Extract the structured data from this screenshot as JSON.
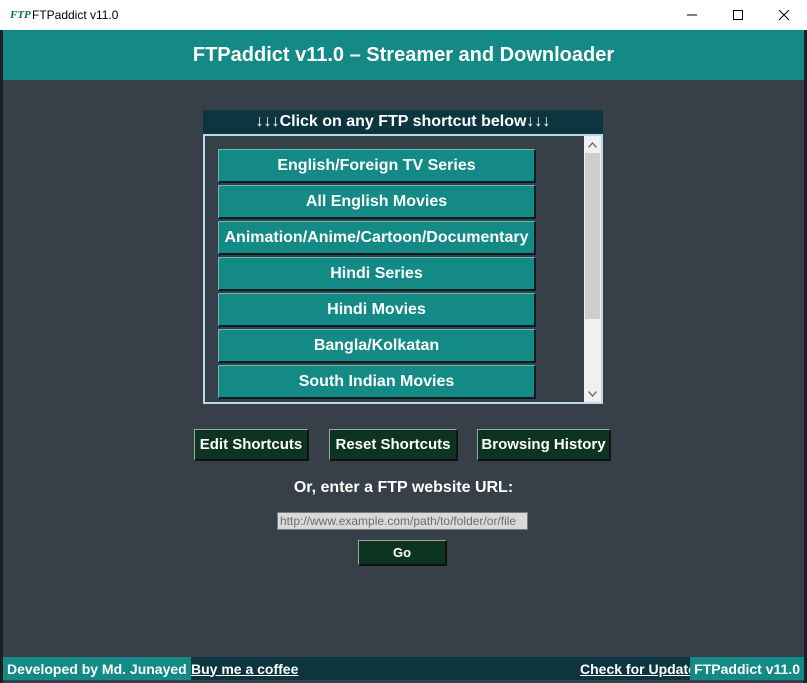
{
  "window": {
    "app_icon_text": "FTP",
    "title": "FTPaddict v11.0",
    "minimize_icon": "minimize-icon",
    "maximize_icon": "maximize-icon",
    "close_icon": "close-icon"
  },
  "header": {
    "title": "FTPaddict v11.0 – Streamer and Downloader"
  },
  "shortcuts": {
    "panel_title": "↓↓↓Click on any FTP shortcut below↓↓↓",
    "items": [
      "English/Foreign TV Series",
      "All English Movies",
      "Animation/Anime/Cartoon/Documentary",
      "Hindi Series",
      "Hindi Movies",
      "Bangla/Kolkatan",
      "South Indian Movies"
    ],
    "scroll_up_icon": "chevron-up-icon",
    "scroll_down_icon": "chevron-down-icon"
  },
  "actions": {
    "edit": "Edit Shortcuts",
    "reset": "Reset Shortcuts",
    "history": "Browsing History"
  },
  "url_entry": {
    "label": "Or, enter a FTP website URL:",
    "placeholder": "http://www.example.com/path/to/folder/or/file",
    "go": "Go"
  },
  "footer": {
    "developer": "Developed by  Md. Junayed",
    "coffee": "Buy me a coffee",
    "update": "Check for Update",
    "version": "FTPaddict v11.0"
  },
  "colors": {
    "teal": "#138a85",
    "dark_navy": "#0d3540",
    "dark_green": "#0d3321",
    "background": "#374049"
  }
}
